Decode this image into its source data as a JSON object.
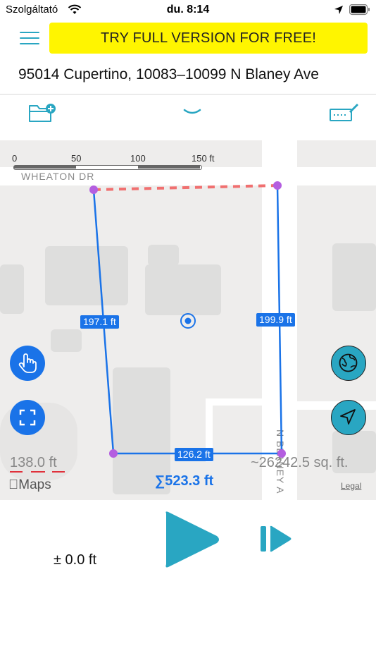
{
  "status_bar": {
    "carrier": "Szolgáltató",
    "time": "du. 8:14"
  },
  "header": {
    "promo_label": "TRY FULL VERSION FOR FREE!",
    "address": "95014 Cupertino, 10083–10099 N Blaney Ave"
  },
  "toolbar": {
    "folder_icon": "folder-add-icon",
    "chevron_icon": "chevron-down-icon",
    "edit_icon": "ruler-pencil-icon"
  },
  "map": {
    "street_top": "WHEATON DR",
    "street_right": "N BLANEY A",
    "scale": {
      "ticks": [
        "0",
        "50",
        "100",
        "150 ft"
      ]
    },
    "segments": {
      "left": "197.1 ft",
      "right": "199.9 ft",
      "bottom": "126.2 ft"
    },
    "left_readout": "138.0 ft",
    "total": "∑523.3 ft",
    "area": "~26242.5 sq. ft.",
    "maps_logo": "Maps",
    "legal": "Legal"
  },
  "controls": {
    "hand_icon": "hand-pointer-icon",
    "fit_icon": "fit-screen-icon",
    "globe_icon": "globe-icon",
    "location_icon": "location-arrow-icon"
  },
  "bottom": {
    "tolerance": "± 0.0 ft",
    "play_icon": "play-icon",
    "step_icon": "step-forward-icon"
  },
  "colors": {
    "accent": "#29a6c2",
    "promo": "#fff500",
    "line_blue": "#1a73e8",
    "vertex": "#b45ee0",
    "dashed_red": "#f07070"
  }
}
